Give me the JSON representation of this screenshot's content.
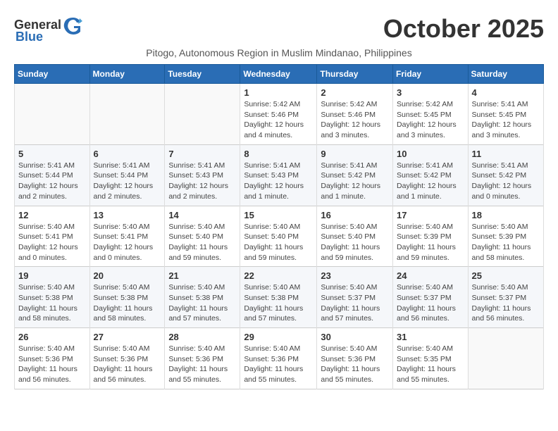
{
  "logo": {
    "general": "General",
    "blue": "Blue"
  },
  "title": "October 2025",
  "subtitle": "Pitogo, Autonomous Region in Muslim Mindanao, Philippines",
  "headers": [
    "Sunday",
    "Monday",
    "Tuesday",
    "Wednesday",
    "Thursday",
    "Friday",
    "Saturday"
  ],
  "weeks": [
    [
      {
        "day": "",
        "info": ""
      },
      {
        "day": "",
        "info": ""
      },
      {
        "day": "",
        "info": ""
      },
      {
        "day": "1",
        "info": "Sunrise: 5:42 AM\nSunset: 5:46 PM\nDaylight: 12 hours\nand 4 minutes."
      },
      {
        "day": "2",
        "info": "Sunrise: 5:42 AM\nSunset: 5:46 PM\nDaylight: 12 hours\nand 3 minutes."
      },
      {
        "day": "3",
        "info": "Sunrise: 5:42 AM\nSunset: 5:45 PM\nDaylight: 12 hours\nand 3 minutes."
      },
      {
        "day": "4",
        "info": "Sunrise: 5:41 AM\nSunset: 5:45 PM\nDaylight: 12 hours\nand 3 minutes."
      }
    ],
    [
      {
        "day": "5",
        "info": "Sunrise: 5:41 AM\nSunset: 5:44 PM\nDaylight: 12 hours\nand 2 minutes."
      },
      {
        "day": "6",
        "info": "Sunrise: 5:41 AM\nSunset: 5:44 PM\nDaylight: 12 hours\nand 2 minutes."
      },
      {
        "day": "7",
        "info": "Sunrise: 5:41 AM\nSunset: 5:43 PM\nDaylight: 12 hours\nand 2 minutes."
      },
      {
        "day": "8",
        "info": "Sunrise: 5:41 AM\nSunset: 5:43 PM\nDaylight: 12 hours\nand 1 minute."
      },
      {
        "day": "9",
        "info": "Sunrise: 5:41 AM\nSunset: 5:42 PM\nDaylight: 12 hours\nand 1 minute."
      },
      {
        "day": "10",
        "info": "Sunrise: 5:41 AM\nSunset: 5:42 PM\nDaylight: 12 hours\nand 1 minute."
      },
      {
        "day": "11",
        "info": "Sunrise: 5:41 AM\nSunset: 5:42 PM\nDaylight: 12 hours\nand 0 minutes."
      }
    ],
    [
      {
        "day": "12",
        "info": "Sunrise: 5:40 AM\nSunset: 5:41 PM\nDaylight: 12 hours\nand 0 minutes."
      },
      {
        "day": "13",
        "info": "Sunrise: 5:40 AM\nSunset: 5:41 PM\nDaylight: 12 hours\nand 0 minutes."
      },
      {
        "day": "14",
        "info": "Sunrise: 5:40 AM\nSunset: 5:40 PM\nDaylight: 11 hours\nand 59 minutes."
      },
      {
        "day": "15",
        "info": "Sunrise: 5:40 AM\nSunset: 5:40 PM\nDaylight: 11 hours\nand 59 minutes."
      },
      {
        "day": "16",
        "info": "Sunrise: 5:40 AM\nSunset: 5:40 PM\nDaylight: 11 hours\nand 59 minutes."
      },
      {
        "day": "17",
        "info": "Sunrise: 5:40 AM\nSunset: 5:39 PM\nDaylight: 11 hours\nand 59 minutes."
      },
      {
        "day": "18",
        "info": "Sunrise: 5:40 AM\nSunset: 5:39 PM\nDaylight: 11 hours\nand 58 minutes."
      }
    ],
    [
      {
        "day": "19",
        "info": "Sunrise: 5:40 AM\nSunset: 5:38 PM\nDaylight: 11 hours\nand 58 minutes."
      },
      {
        "day": "20",
        "info": "Sunrise: 5:40 AM\nSunset: 5:38 PM\nDaylight: 11 hours\nand 58 minutes."
      },
      {
        "day": "21",
        "info": "Sunrise: 5:40 AM\nSunset: 5:38 PM\nDaylight: 11 hours\nand 57 minutes."
      },
      {
        "day": "22",
        "info": "Sunrise: 5:40 AM\nSunset: 5:38 PM\nDaylight: 11 hours\nand 57 minutes."
      },
      {
        "day": "23",
        "info": "Sunrise: 5:40 AM\nSunset: 5:37 PM\nDaylight: 11 hours\nand 57 minutes."
      },
      {
        "day": "24",
        "info": "Sunrise: 5:40 AM\nSunset: 5:37 PM\nDaylight: 11 hours\nand 56 minutes."
      },
      {
        "day": "25",
        "info": "Sunrise: 5:40 AM\nSunset: 5:37 PM\nDaylight: 11 hours\nand 56 minutes."
      }
    ],
    [
      {
        "day": "26",
        "info": "Sunrise: 5:40 AM\nSunset: 5:36 PM\nDaylight: 11 hours\nand 56 minutes."
      },
      {
        "day": "27",
        "info": "Sunrise: 5:40 AM\nSunset: 5:36 PM\nDaylight: 11 hours\nand 56 minutes."
      },
      {
        "day": "28",
        "info": "Sunrise: 5:40 AM\nSunset: 5:36 PM\nDaylight: 11 hours\nand 55 minutes."
      },
      {
        "day": "29",
        "info": "Sunrise: 5:40 AM\nSunset: 5:36 PM\nDaylight: 11 hours\nand 55 minutes."
      },
      {
        "day": "30",
        "info": "Sunrise: 5:40 AM\nSunset: 5:36 PM\nDaylight: 11 hours\nand 55 minutes."
      },
      {
        "day": "31",
        "info": "Sunrise: 5:40 AM\nSunset: 5:35 PM\nDaylight: 11 hours\nand 55 minutes."
      },
      {
        "day": "",
        "info": ""
      }
    ]
  ]
}
